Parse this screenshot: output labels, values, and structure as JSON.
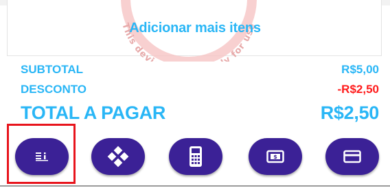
{
  "cart": {
    "add_more_label": "Adicionar mais itens",
    "watermark_text": "This device is not ready for use"
  },
  "summary": {
    "subtotal_label": "SUBTOTAL",
    "subtotal_value": "R$5,00",
    "discount_label": "DESCONTO",
    "discount_value": "-R$2,50",
    "total_label": "TOTAL A PAGAR",
    "total_value": "R$2,50"
  },
  "payment_methods": [
    {
      "icon": "list-icon",
      "selected": true
    },
    {
      "icon": "pix-icon",
      "selected": false
    },
    {
      "icon": "pos-terminal-icon",
      "selected": false
    },
    {
      "icon": "cash-icon",
      "selected": false
    },
    {
      "icon": "credit-card-icon",
      "selected": false
    }
  ],
  "colors": {
    "accent": "#29b6f6",
    "negative": "#ff1a1a",
    "button": "#3b2196",
    "selection": "#e8141c"
  }
}
